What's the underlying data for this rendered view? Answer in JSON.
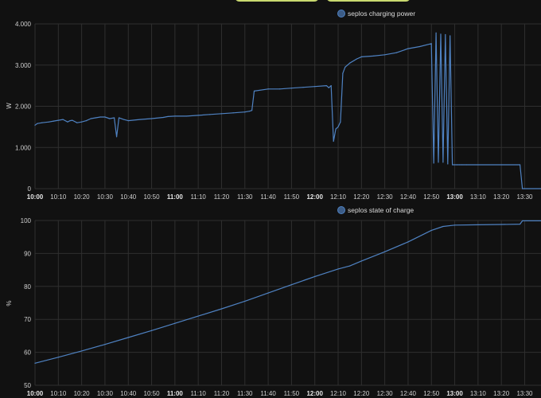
{
  "toolbar": {
    "buttons": [
      "",
      ""
    ]
  },
  "colors": {
    "background": "#111111",
    "grid": "#2f2f2f",
    "series": "#4f82c2",
    "button_border": "#c9d96f"
  },
  "chart_data": [
    {
      "type": "line",
      "title": "",
      "legend": [
        "seplos charging power"
      ],
      "ylabel": "W",
      "ylim": [
        0,
        4000
      ],
      "yticks": [
        "0",
        "1.000",
        "2.000",
        "3.000",
        "4.000"
      ],
      "yvals": [
        0,
        1000,
        2000,
        3000,
        4000
      ],
      "xlim": [
        "10:00",
        "13:37"
      ],
      "xticks": [
        "10:00",
        "10:10",
        "10:20",
        "10:30",
        "10:40",
        "10:50",
        "11:00",
        "11:10",
        "11:20",
        "11:30",
        "11:40",
        "11:50",
        "12:00",
        "12:10",
        "12:20",
        "12:30",
        "12:40",
        "12:50",
        "13:00",
        "13:10",
        "13:20",
        "13:30"
      ],
      "bold_ticks": [
        "10:00",
        "11:00",
        "12:00",
        "13:00"
      ],
      "grid": true,
      "legend_position": "top",
      "series": [
        {
          "name": "seplos charging power",
          "x": [
            "10:00",
            "10:01",
            "10:03",
            "10:06",
            "10:08",
            "10:10",
            "10:12",
            "10:14",
            "10:15",
            "10:16",
            "10:18",
            "10:20",
            "10:22",
            "10:24",
            "10:26",
            "10:28",
            "10:30",
            "10:32",
            "10:34",
            "10:35",
            "10:36",
            "10:38",
            "10:40",
            "10:45",
            "10:50",
            "10:55",
            "10:57",
            "11:00",
            "11:05",
            "11:10",
            "11:15",
            "11:20",
            "11:25",
            "11:30",
            "11:32",
            "11:33",
            "11:34",
            "11:40",
            "11:45",
            "11:50",
            "11:55",
            "12:00",
            "12:05",
            "12:06",
            "12:07",
            "12:08",
            "12:09",
            "12:10",
            "12:11",
            "12:12",
            "12:13",
            "12:14",
            "12:15",
            "12:18",
            "12:20",
            "12:25",
            "12:30",
            "12:35",
            "12:40",
            "12:45",
            "12:50",
            "12:51",
            "12:52",
            "12:53",
            "12:54",
            "12:55",
            "12:56",
            "12:57",
            "12:58",
            "12:59",
            "13:00",
            "13:01",
            "13:02",
            "13:03",
            "13:05",
            "13:10",
            "13:20",
            "13:28",
            "13:29",
            "13:30",
            "13:37"
          ],
          "values": [
            1540,
            1580,
            1600,
            1620,
            1640,
            1660,
            1680,
            1620,
            1650,
            1660,
            1600,
            1620,
            1650,
            1700,
            1720,
            1740,
            1740,
            1700,
            1720,
            1260,
            1720,
            1680,
            1650,
            1680,
            1700,
            1730,
            1750,
            1760,
            1760,
            1780,
            1800,
            1820,
            1840,
            1860,
            1880,
            1900,
            2370,
            2420,
            2420,
            2440,
            2460,
            2480,
            2500,
            2450,
            2500,
            1150,
            1450,
            1500,
            1620,
            2800,
            2950,
            3000,
            3050,
            3150,
            3200,
            3220,
            3250,
            3300,
            3400,
            3450,
            3520,
            620,
            3780,
            640,
            3750,
            640,
            3740,
            600,
            3710,
            580,
            580,
            580,
            580,
            580,
            580,
            580,
            580,
            580,
            0,
            0,
            0
          ]
        }
      ]
    },
    {
      "type": "line",
      "title": "",
      "legend": [
        "seplos state of charge"
      ],
      "ylabel": "%",
      "ylim": [
        50,
        100
      ],
      "yticks": [
        "50",
        "60",
        "70",
        "80",
        "90",
        "100"
      ],
      "yvals": [
        50,
        60,
        70,
        80,
        90,
        100
      ],
      "xlim": [
        "10:00",
        "13:37"
      ],
      "xticks": [
        "10:00",
        "10:10",
        "10:20",
        "10:30",
        "10:40",
        "10:50",
        "11:00",
        "11:10",
        "11:20",
        "11:30",
        "11:40",
        "11:50",
        "12:00",
        "12:10",
        "12:20",
        "12:30",
        "12:40",
        "12:50",
        "13:00",
        "13:10",
        "13:20",
        "13:30"
      ],
      "bold_ticks": [
        "10:00",
        "11:00",
        "12:00",
        "13:00"
      ],
      "grid": true,
      "legend_position": "top",
      "series": [
        {
          "name": "seplos state of charge",
          "x": [
            "10:00",
            "10:10",
            "10:20",
            "10:30",
            "10:40",
            "10:50",
            "11:00",
            "11:10",
            "11:20",
            "11:30",
            "11:40",
            "11:50",
            "12:00",
            "12:10",
            "12:15",
            "12:20",
            "12:30",
            "12:40",
            "12:50",
            "12:55",
            "13:00",
            "13:10",
            "13:20",
            "13:28",
            "13:29",
            "13:37"
          ],
          "values": [
            56.7,
            58.5,
            60.4,
            62.4,
            64.5,
            66.6,
            68.8,
            71.0,
            73.2,
            75.5,
            78.0,
            80.5,
            83.0,
            85.3,
            86.2,
            87.7,
            90.5,
            93.5,
            97.0,
            98.2,
            98.6,
            98.7,
            98.8,
            98.9,
            99.9,
            99.9
          ]
        }
      ]
    }
  ]
}
